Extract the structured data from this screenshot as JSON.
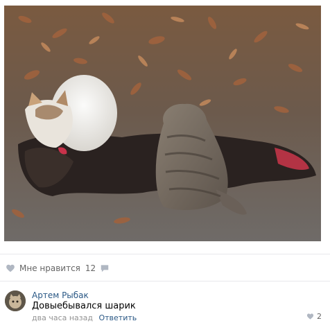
{
  "post": {
    "photo_alt": "cats",
    "likes_label": "Мне нравится",
    "likes_count": "12"
  },
  "comment": {
    "author": "Артем Рыбак",
    "text": "Довыебывался шарик",
    "time": "два часа назад",
    "reply_label": "Ответить",
    "likes_count": "2"
  },
  "colors": {
    "link": "#2a5885",
    "muted": "#939393",
    "icon": "#b0b7c2"
  },
  "icons": [
    "heart-icon",
    "share-icon",
    "avatar"
  ]
}
